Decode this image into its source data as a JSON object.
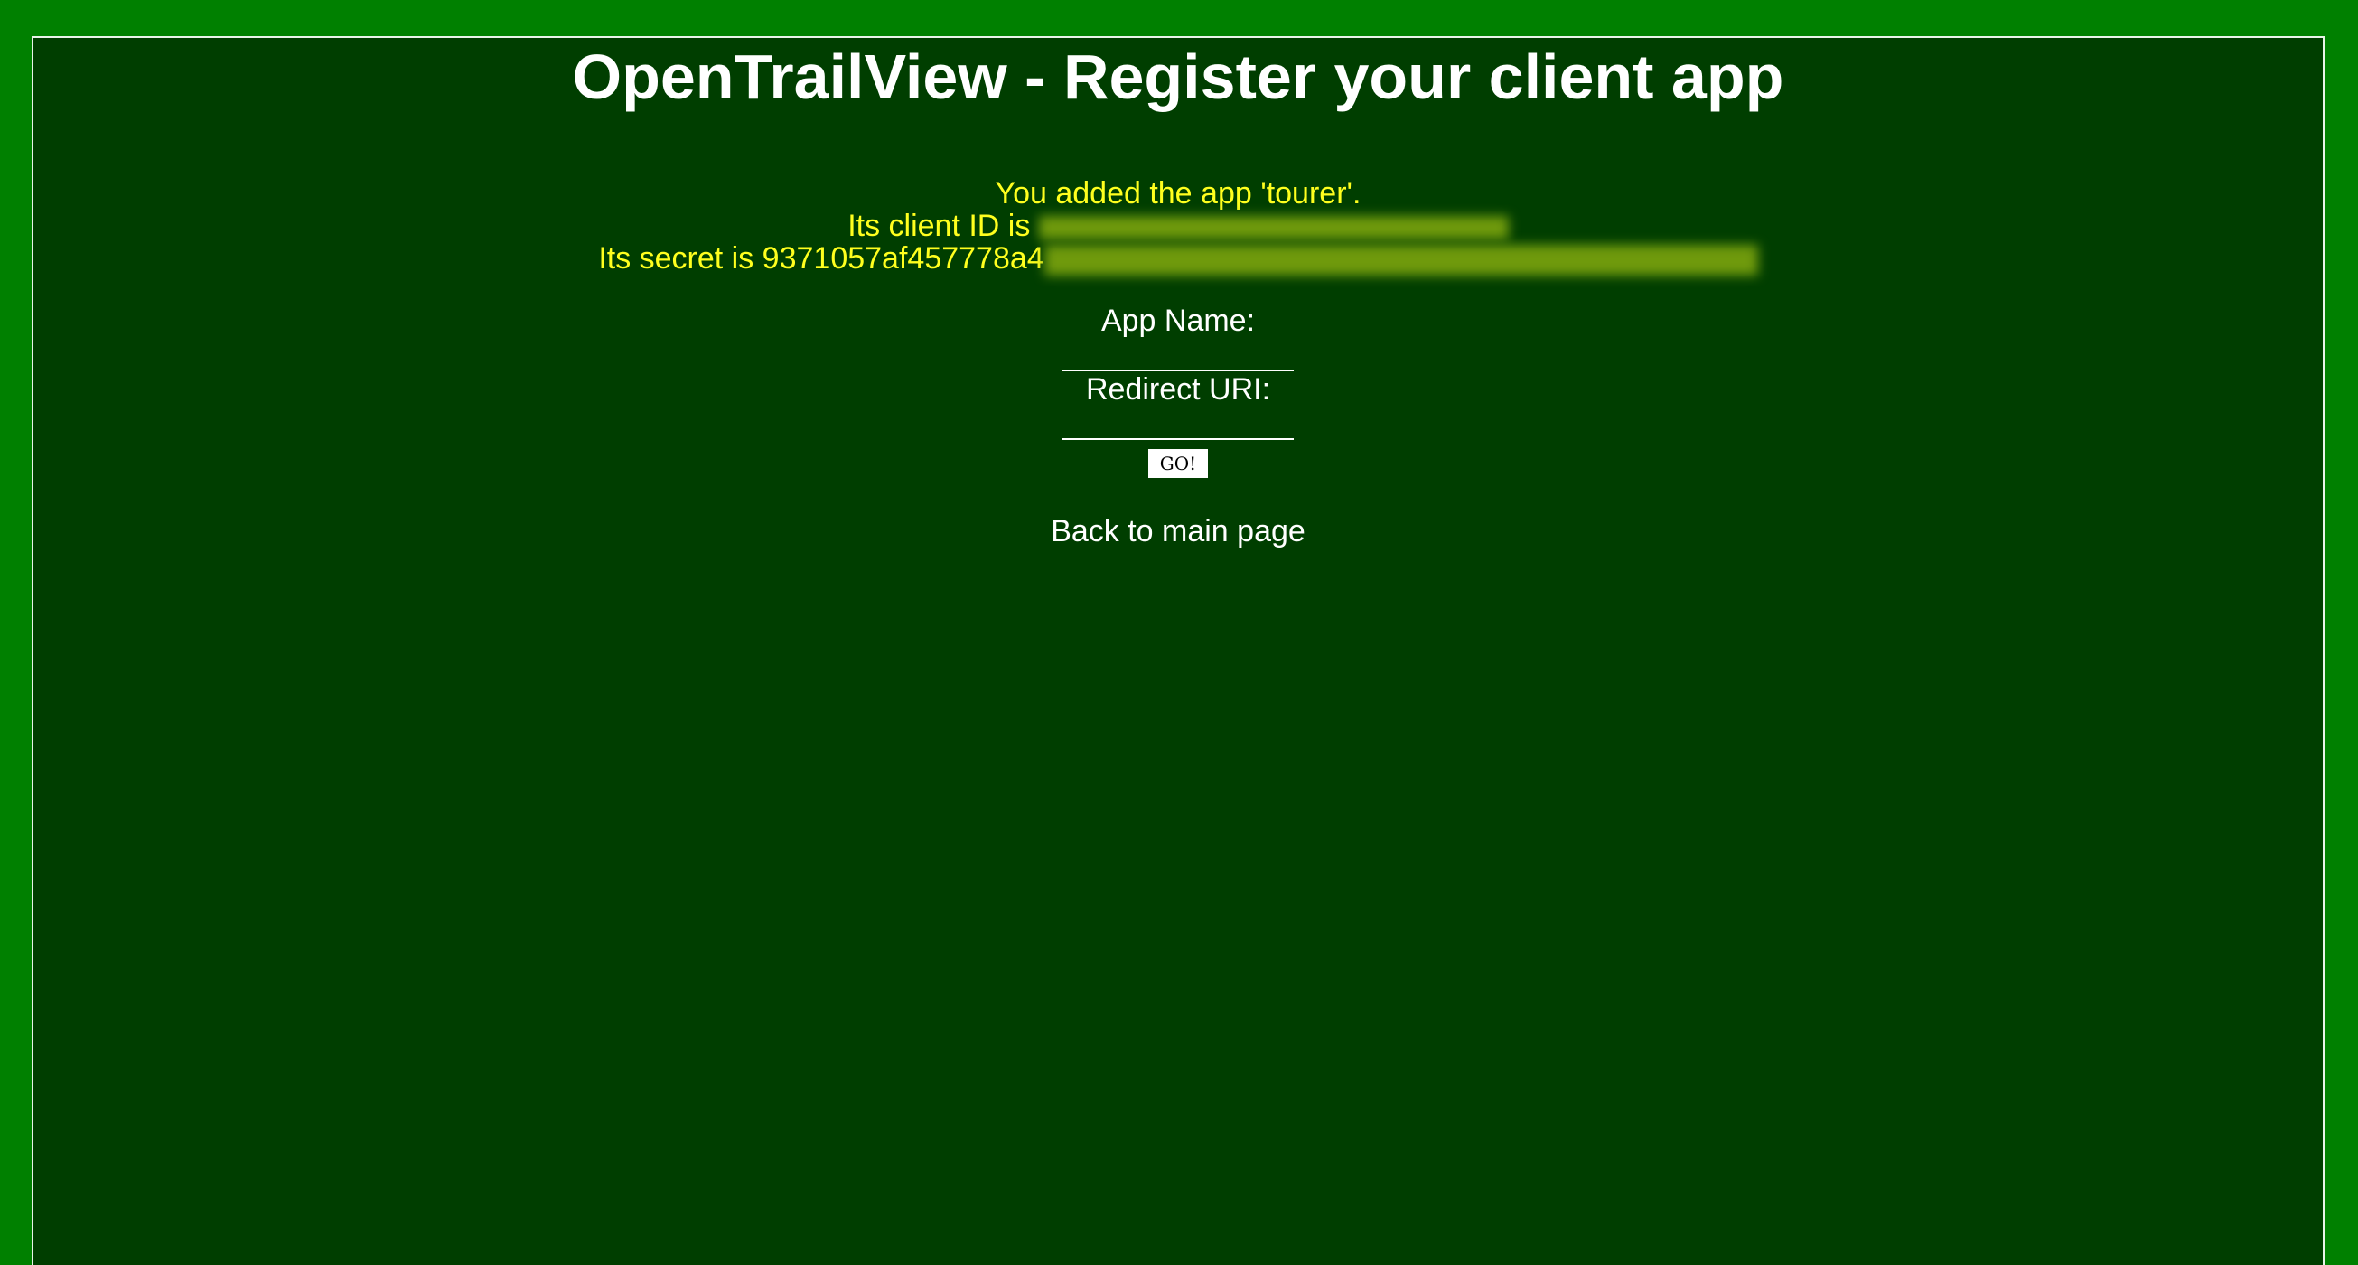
{
  "page": {
    "title": "OpenTrailView - Register your client app"
  },
  "message": {
    "added_line": "You added the app 'tourer'.",
    "client_id_prefix": "Its client ID is ",
    "secret_prefix": "Its secret is 9371057af457778a4"
  },
  "form": {
    "app_name_label": "App Name:",
    "app_name_value": "",
    "redirect_uri_label": "Redirect URI:",
    "redirect_uri_value": "",
    "submit_label": "GO!"
  },
  "footer": {
    "back_link_label": "Back to main page"
  },
  "colors": {
    "page_background": "#008000",
    "panel_background": "#003e00",
    "message_text": "#ffff1e",
    "text": "#ffffff"
  }
}
